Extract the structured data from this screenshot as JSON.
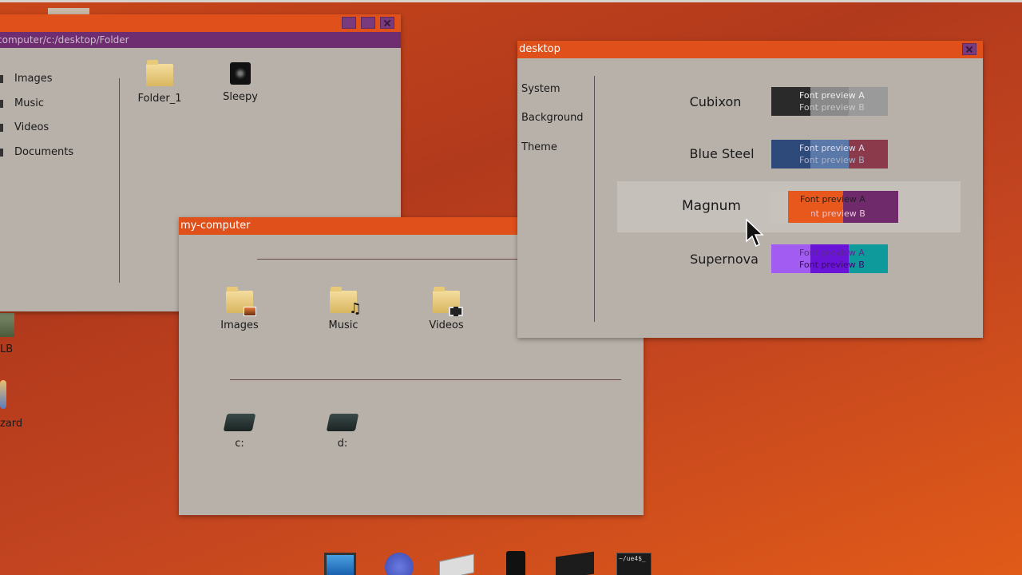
{
  "colors": {
    "titlebar": "#e0501a",
    "pathbar": "#6e2d70",
    "window_bg": "#b8b1aa"
  },
  "folder_window": {
    "path": "computer/c:/desktop/Folder",
    "sidebar": [
      {
        "label": "Images",
        "icon": "image-icon"
      },
      {
        "label": "Music",
        "icon": "music-icon"
      },
      {
        "label": "Videos",
        "icon": "video-icon"
      },
      {
        "label": "Documents",
        "icon": "document-icon"
      }
    ],
    "files": [
      {
        "label": "Folder_1",
        "icon": "folder-icon"
      },
      {
        "label": "Sleepy",
        "icon": "speaker-icon"
      }
    ]
  },
  "my_computer": {
    "title": "my-computer",
    "folders": [
      {
        "label": "Images",
        "icon": "images-folder-icon"
      },
      {
        "label": "Music",
        "icon": "music-folder-icon"
      },
      {
        "label": "Videos",
        "icon": "videos-folder-icon"
      }
    ],
    "drives": [
      {
        "label": "c:",
        "icon": "drive-icon"
      },
      {
        "label": "d:",
        "icon": "drive-icon"
      }
    ]
  },
  "desktop_window": {
    "title": "desktop",
    "menu": [
      "System",
      "Background",
      "Theme"
    ],
    "themes": [
      {
        "name": "Cubixon",
        "font_a": "Font preview A",
        "font_b": "Font preview B",
        "colors": [
          "#2a2a2a",
          "#8a8a8a",
          "#9a9a9a"
        ]
      },
      {
        "name": "Blue Steel",
        "font_a": "Font preview A",
        "font_b": "Font preview B",
        "colors": [
          "#2e4a7a",
          "#5a78a8",
          "#8a3a4a"
        ]
      },
      {
        "name": "Magnum",
        "font_a": "Font preview A",
        "font_b": "Font preview B",
        "colors": [
          "#c8c2bc",
          "#e8581c",
          "#6e2a6a"
        ]
      },
      {
        "name": "Supernova",
        "font_a": "Font preview A",
        "font_b": "Font preview B",
        "colors": [
          "#a35cf2",
          "#6a14d8",
          "#0e9a9a"
        ]
      }
    ]
  },
  "desktop_icons": [
    {
      "label": "LB"
    },
    {
      "label": "zard"
    }
  ],
  "dock": [
    {
      "icon": "computer-icon"
    },
    {
      "icon": "basket-icon"
    },
    {
      "icon": "mail-icon"
    },
    {
      "icon": "speaker-icon"
    },
    {
      "icon": "media-player-icon"
    },
    {
      "icon": "terminal-icon",
      "label": "~/ue4$_"
    }
  ]
}
